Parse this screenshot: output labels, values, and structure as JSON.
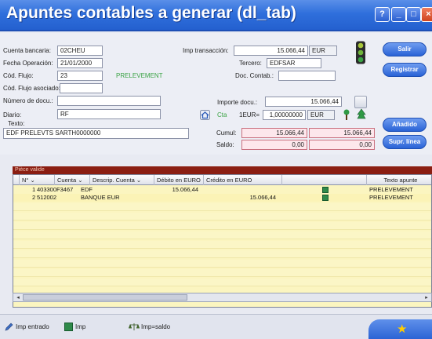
{
  "window": {
    "title": "Apuntes contables a generar (dl_tab)",
    "buttons": {
      "help": "?",
      "minimize": "_",
      "maximize": "□",
      "close": "×"
    }
  },
  "form": {
    "cuenta_bancaria": {
      "label": "Cuenta bancaria:",
      "value": "02CHEU"
    },
    "fecha_operacion": {
      "label": "Fecha Operación:",
      "value": "21/01/2000"
    },
    "cod_flujo": {
      "label": "Cód. Flujo:",
      "value": "23",
      "desc": "PRELEVEMENT"
    },
    "cod_flujo_asociado": {
      "label": "Cód. Flujo asociado:",
      "value": ""
    },
    "numero_docu": {
      "label": "Número de docu.:",
      "value": ""
    },
    "diario": {
      "label": "Diario:",
      "value": "RF"
    },
    "texto": {
      "label": "Texto:",
      "value": "EDF PRELEVTS SARTH0000000"
    },
    "imp_transaccion": {
      "label": "Imp transacción:",
      "value": "15.066,44",
      "currency": "EUR"
    },
    "tercero": {
      "label": "Tercero:",
      "value": "EDFSAR"
    },
    "doc_contab": {
      "label": "Doc. Contab.:",
      "value": ""
    },
    "importe_docu": {
      "label": "Importe docu.:",
      "value": "15.066,44"
    },
    "cta": {
      "label": "Cta",
      "rate_label": "1EUR=",
      "rate": "1,00000000",
      "currency": "EUR"
    },
    "cumul": {
      "label": "Cumul:",
      "debit": "15.066,44",
      "credit": "15.066,44"
    },
    "saldo": {
      "label": "Saldo:",
      "debit": "0,00",
      "credit": "0,00"
    }
  },
  "side_buttons": {
    "salir": "Salir",
    "registrar": "Registrar",
    "anadido": "Añadido",
    "supr_linea": "Supr. línea"
  },
  "grid": {
    "caption": "Pièce valide",
    "columns": [
      "N°",
      "Cuenta",
      "Descrip. Cuenta",
      "Débito en EURO",
      "Crédito en EURO",
      "",
      "Texto apunte"
    ],
    "rows": [
      {
        "n": "1",
        "cuenta": "403300F3467",
        "descrip": "EDF",
        "debito": "15.066,44",
        "credito": "",
        "texto": "PRELEVEMENT"
      },
      {
        "n": "2",
        "cuenta": "512002",
        "descrip": "BANQUE EUR",
        "debito": "",
        "credito": "15.066,44",
        "texto": "PRELEVEMENT"
      }
    ]
  },
  "footer": {
    "legend": [
      {
        "icon": "pen-icon",
        "label": "Imp entrado"
      },
      {
        "icon": "grid-icon",
        "label": "Imp"
      },
      {
        "icon": "balance-icon",
        "label": "Imp=saldo"
      }
    ]
  },
  "colors": {
    "titlebar": "#2f6fdc",
    "grid_background": "#fbf5c0",
    "caption_bar": "#8b1e12",
    "accent_green": "#3aa344"
  }
}
